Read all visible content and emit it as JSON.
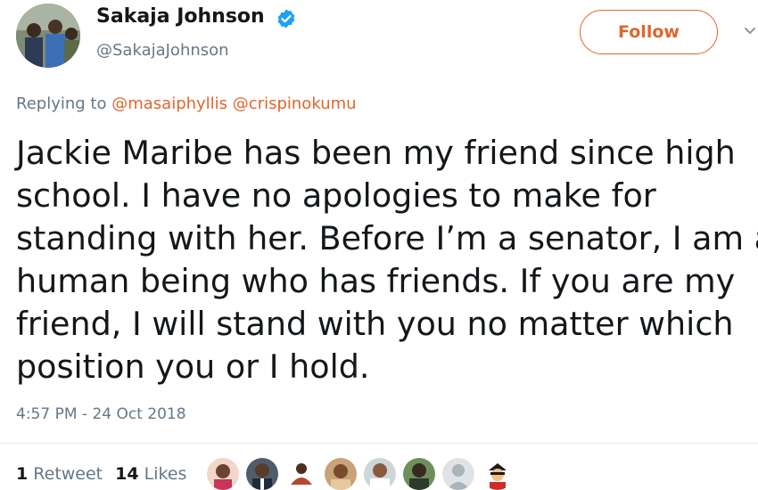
{
  "author": {
    "display_name": "Sakaja Johnson",
    "handle": "@SakajaJohnson",
    "avatar_icon": "profile-photo-icon",
    "verified_icon": "verified-badge-icon"
  },
  "follow_button": {
    "label": "Follow"
  },
  "menu": {
    "icon": "chevron-down-icon"
  },
  "reply": {
    "prefix": "Replying to",
    "mentions": [
      "@masaiphyllis",
      "@crispinokumu"
    ]
  },
  "tweet": {
    "text_lines": [
      "Jackie Maribe has been my friend since high",
      "school. I have no apologies to make for",
      "standing with her. Before I’m a senator, I am a",
      "human being who has friends. If you are my",
      "friend, I will stand with you no matter which",
      "position you or I hold."
    ],
    "timestamp": "4:57 PM - 24 Oct 2018"
  },
  "stats": {
    "retweets_count": "1",
    "retweets_label": "Retweet",
    "likes_count": "14",
    "likes_label": "Likes"
  },
  "likers": [
    {
      "name": "liker-avatar-1-icon"
    },
    {
      "name": "liker-avatar-2-icon"
    },
    {
      "name": "liker-avatar-3-icon"
    },
    {
      "name": "liker-avatar-4-icon"
    },
    {
      "name": "liker-avatar-5-icon"
    },
    {
      "name": "liker-avatar-6-icon"
    },
    {
      "name": "liker-avatar-7-icon"
    },
    {
      "name": "liker-avatar-8-icon"
    }
  ],
  "colors": {
    "accent": "#e0662d",
    "text_primary": "#14171a",
    "text_secondary": "#657786",
    "verified_blue": "#1da1f2",
    "divider": "#e6ecf0"
  }
}
